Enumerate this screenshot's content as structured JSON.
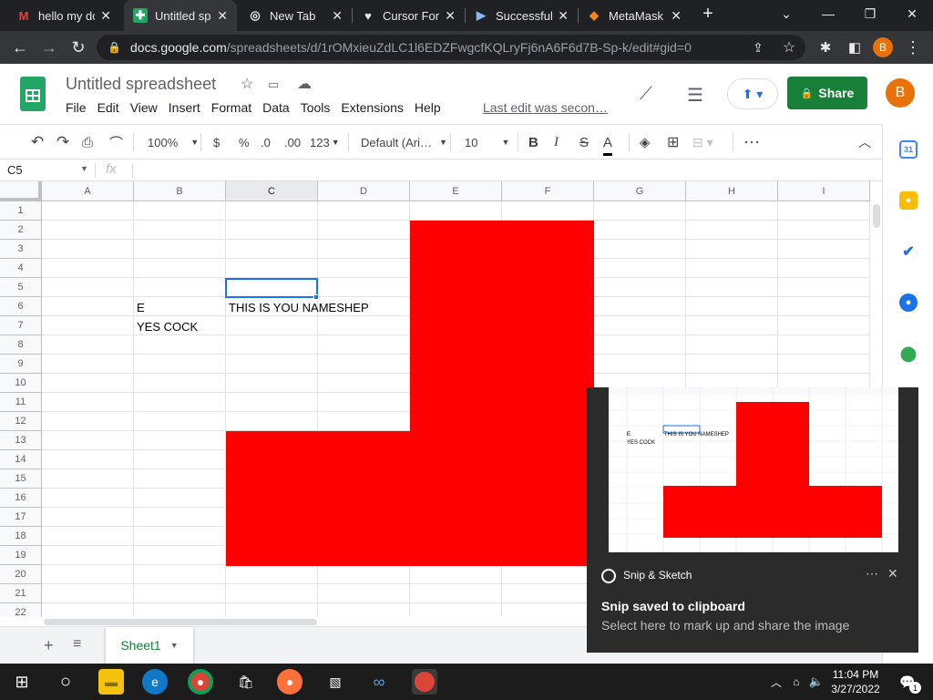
{
  "browser": {
    "tabs": [
      {
        "label": "hello my dc",
        "icon": "gmail-icon",
        "glyph": "M",
        "color": "#ea4335"
      },
      {
        "label": "Untitled spr",
        "icon": "sheets-icon",
        "glyph": "",
        "color": "#23a566"
      },
      {
        "label": "New Tab",
        "icon": "chrome-icon",
        "glyph": "◎",
        "color": "#e8eaed"
      },
      {
        "label": "Cursor For",
        "icon": "cursor-icon",
        "glyph": "♥",
        "color": "#e8eaed"
      },
      {
        "label": "Successful",
        "icon": "play-icon",
        "glyph": "▶",
        "color": "#8ab4f8"
      },
      {
        "label": "MetaMask",
        "icon": "metamask-icon",
        "glyph": "◆",
        "color": "#f6851b"
      }
    ],
    "new_tab": "+",
    "url_domain": "docs.google.com",
    "url_path": "/spreadsheets/d/1rOMxieuZdLC1l6EDZFwgcfKQLryFj6nA6F6d7B-Sp-k/edit#gid=0",
    "profile_letter": "B"
  },
  "sheets": {
    "title": "Untitled spreadsheet",
    "menu": [
      "File",
      "Edit",
      "View",
      "Insert",
      "Format",
      "Data",
      "Tools",
      "Extensions",
      "Help"
    ],
    "last_edit": "Last edit was secon…",
    "share_label": "Share",
    "user_letter": "B",
    "toolbar": {
      "zoom": "100%",
      "currency": "$",
      "percent": "%",
      "dec_decrease": ".0",
      "dec_increase": ".00",
      "format_more": "123",
      "font": "Default (Ari…",
      "font_size": "10",
      "bold": "B",
      "italic": "I",
      "strike": "S",
      "text_color": "A"
    },
    "namebox": "C5",
    "fx": "fx",
    "columns": [
      "A",
      "B",
      "C",
      "D",
      "E",
      "F",
      "G",
      "H",
      "I"
    ],
    "rows": [
      "1",
      "2",
      "3",
      "4",
      "5",
      "6",
      "7",
      "8",
      "9",
      "10",
      "11",
      "12",
      "13",
      "14",
      "15",
      "16",
      "17",
      "18",
      "19",
      "20",
      "21",
      "22"
    ],
    "cells": {
      "B6": "E",
      "C6": "THIS IS YOU NAMESHEP",
      "B7": "YES COCK"
    },
    "fill_color": "#ff0000",
    "sheet_tab": "Sheet1"
  },
  "toast": {
    "app": "Snip & Sketch",
    "title": "Snip saved to clipboard",
    "body": "Select here to mark up and share the image",
    "thumb_text_b6": "E",
    "thumb_text_c6": "THIS IS YOU NAMESHEP",
    "thumb_text_b7": "YES COCK"
  },
  "taskbar": {
    "time": "11:04 PM",
    "date": "3/27/2022",
    "notification_count": "1"
  }
}
